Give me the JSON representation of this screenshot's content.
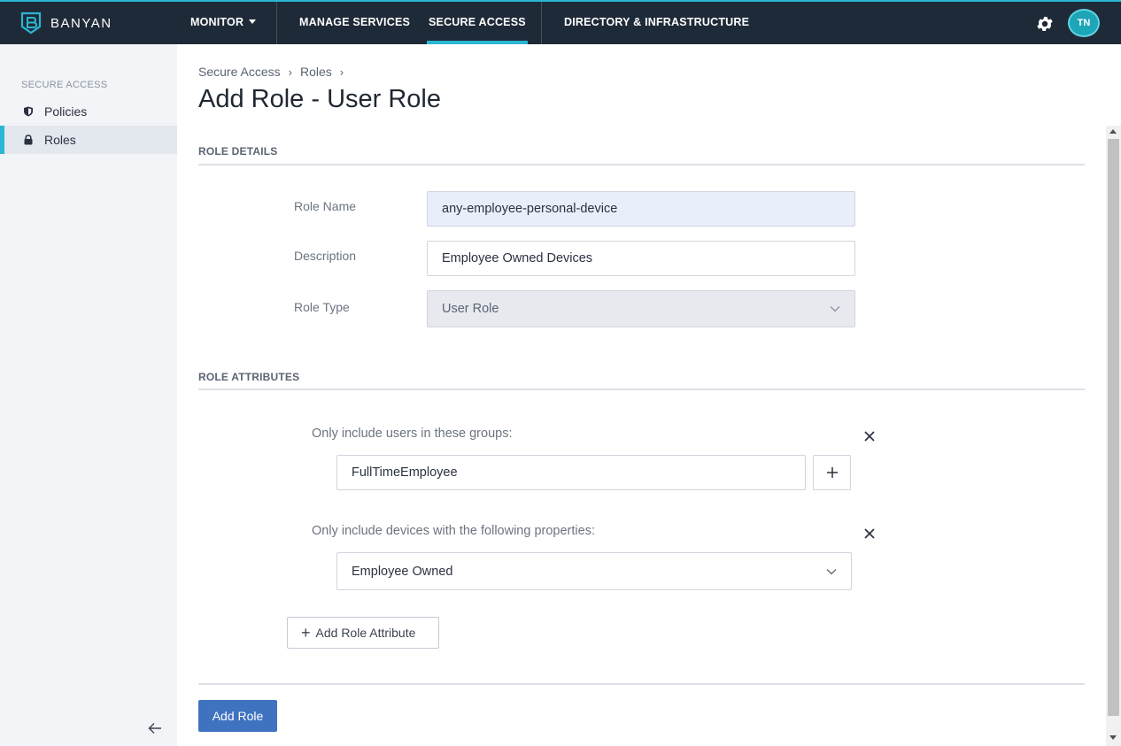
{
  "brand": {
    "name": "BANYAN"
  },
  "nav": {
    "monitor": "MONITOR",
    "manage_services": "MANAGE SERVICES",
    "secure_access": "SECURE ACCESS",
    "directory": "DIRECTORY & INFRASTRUCTURE",
    "avatar_initials": "TN"
  },
  "sidebar": {
    "section": "SECURE ACCESS",
    "items": [
      {
        "label": "Policies",
        "icon": "shield-icon"
      },
      {
        "label": "Roles",
        "icon": "lock-icon",
        "active": true
      }
    ]
  },
  "breadcrumb": [
    "Secure Access",
    "Roles"
  ],
  "page": {
    "title": "Add Role - User Role"
  },
  "role_details": {
    "section_title": "ROLE DETAILS",
    "role_name": {
      "label": "Role Name",
      "value": "any-employee-personal-device"
    },
    "description": {
      "label": "Description",
      "value": "Employee Owned Devices"
    },
    "role_type": {
      "label": "Role Type",
      "value": "User Role"
    }
  },
  "role_attributes": {
    "section_title": "ROLE ATTRIBUTES",
    "groups": {
      "label": "Only include users in these groups:",
      "value": "FullTimeEmployee"
    },
    "devices": {
      "label": "Only include devices with the following properties:",
      "value": "Employee Owned"
    },
    "add_attribute_label": "Add Role Attribute"
  },
  "actions": {
    "add_role": "Add Role"
  },
  "colors": {
    "accent": "#2bb6d3",
    "primary_button": "#3f72bf",
    "topbar": "#1f2a38"
  }
}
